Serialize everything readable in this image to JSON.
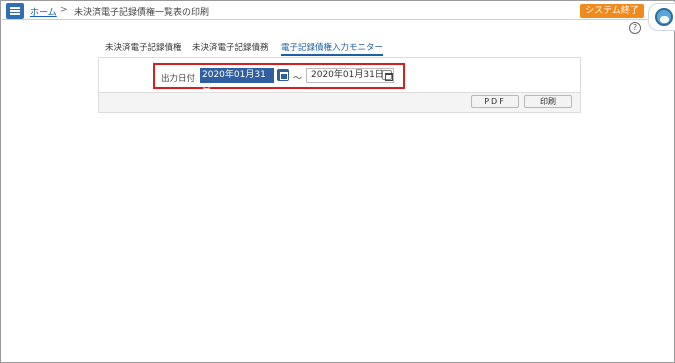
{
  "header": {
    "home_link": "ホーム",
    "separator": ">",
    "page_title": "未決済電子記録債権一覧表の印刷",
    "exit_button": "システム終了"
  },
  "help": {
    "label": "?"
  },
  "tabs": [
    {
      "label": "未決済電子記録債権",
      "active": false
    },
    {
      "label": "未決済電子記録債務",
      "active": false
    },
    {
      "label": "電子記録債権入力モニター",
      "active": true
    }
  ],
  "form": {
    "date_label": "出力日付",
    "date_from": "2020年01月31日",
    "range_separator": "〜",
    "date_to": "2020年01月31日"
  },
  "actions": {
    "pdf_label": "PDF",
    "print_label": "印刷"
  },
  "colors": {
    "accent_blue": "#2f5fa0",
    "exit_orange": "#f08a1c",
    "highlight_red": "#d62020"
  }
}
